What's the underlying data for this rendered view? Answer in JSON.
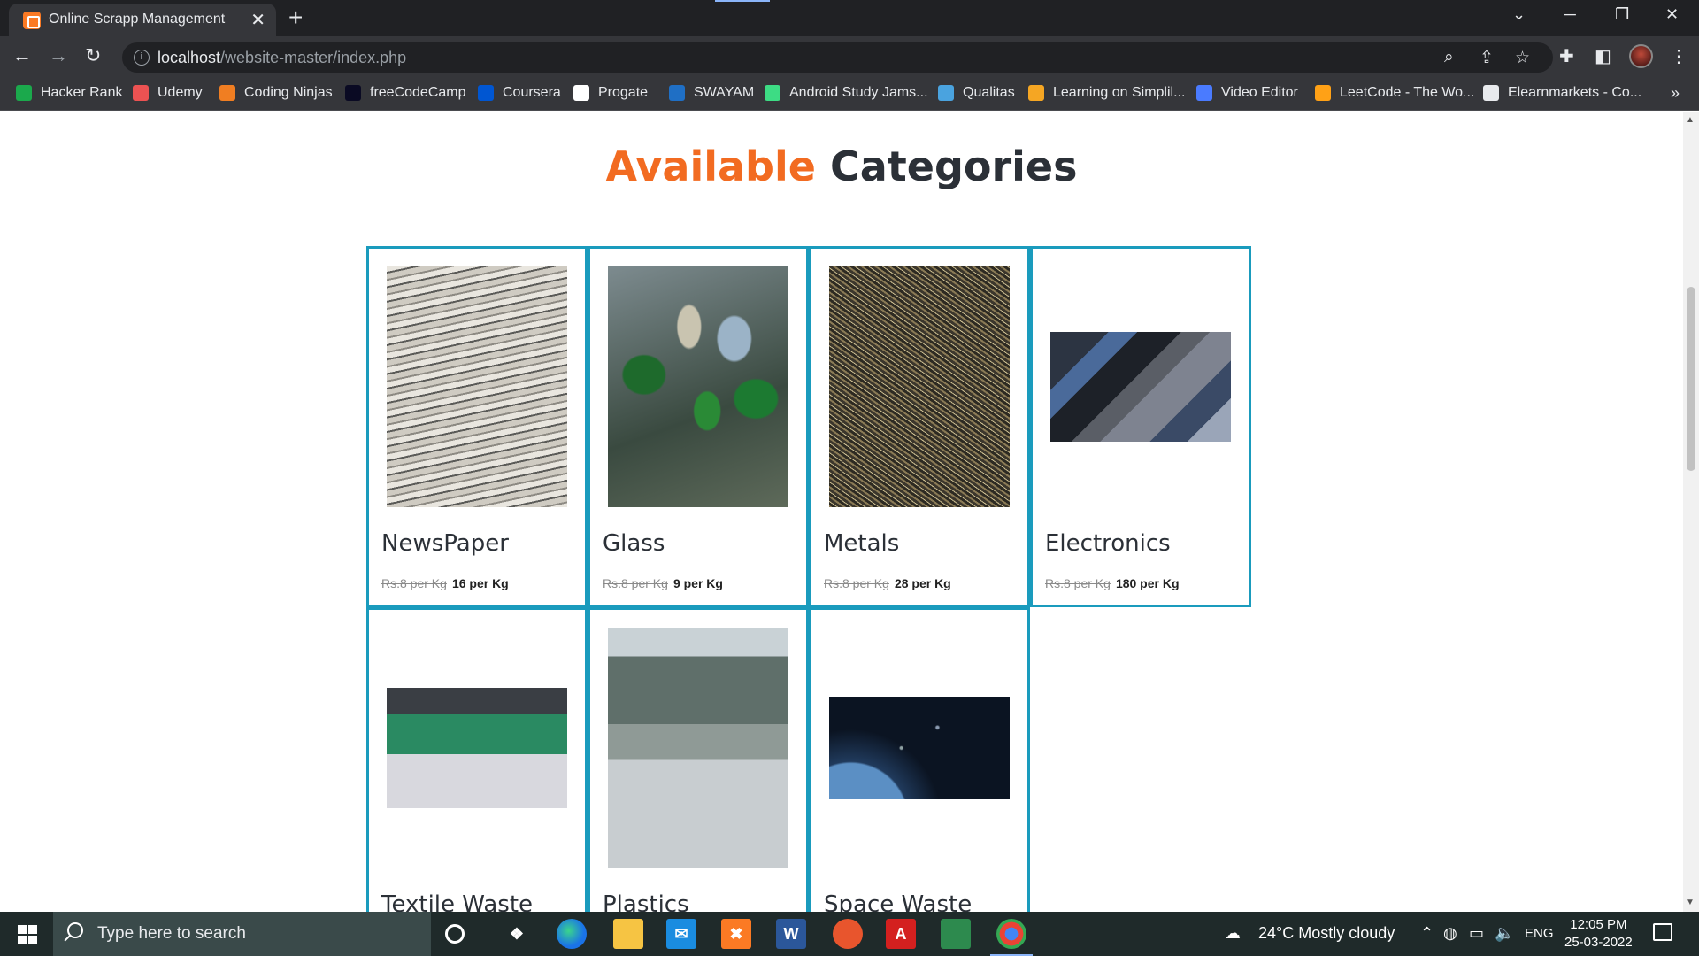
{
  "browser": {
    "tab_title": "Online Scrapp Management",
    "url_host": "localhost",
    "url_path": "/website-master/index.php",
    "bookmarks": [
      {
        "label": "Hacker Rank",
        "icon": "hackerrank-icon",
        "color": "#1ba94c"
      },
      {
        "label": "Udemy",
        "icon": "udemy-icon",
        "color": "#ec5252"
      },
      {
        "label": "Coding Ninjas",
        "icon": "codingninjas-icon",
        "color": "#f07e22"
      },
      {
        "label": "freeCodeCamp",
        "icon": "freecodecamp-icon",
        "color": "#0a0a23"
      },
      {
        "label": "Coursera",
        "icon": "coursera-icon",
        "color": "#0056d2"
      },
      {
        "label": "Progate",
        "icon": "progate-icon",
        "color": "#ffffff"
      },
      {
        "label": "SWAYAM",
        "icon": "swayam-icon",
        "color": "#1f6fc5"
      },
      {
        "label": "Android Study Jams...",
        "icon": "android-icon",
        "color": "#3ddc84"
      },
      {
        "label": "Qualitas",
        "icon": "qualitas-icon",
        "color": "#4aa3df"
      },
      {
        "label": "Learning on Simplil...",
        "icon": "simplilearn-icon",
        "color": "#f5a623"
      },
      {
        "label": "Video Editor",
        "icon": "video-editor-icon",
        "color": "#4a7bff"
      },
      {
        "label": "LeetCode - The Wo...",
        "icon": "leetcode-icon",
        "color": "#ffa116"
      },
      {
        "label": "Elearnmarkets - Co...",
        "icon": "elearnmarkets-icon",
        "color": "#e8eaed"
      }
    ]
  },
  "page": {
    "heading_highlight": "Available",
    "heading_rest": "Categories",
    "categories": [
      {
        "name": "NewsPaper",
        "old_price": "Rs.8 per Kg",
        "new_price": "16 per Kg"
      },
      {
        "name": "Glass",
        "old_price": "Rs.8 per Kg",
        "new_price": "9 per Kg"
      },
      {
        "name": "Metals",
        "old_price": "Rs.8 per Kg",
        "new_price": "28 per Kg"
      },
      {
        "name": "Electronics",
        "old_price": "Rs.8 per Kg",
        "new_price": "180 per Kg"
      },
      {
        "name": "Textile Waste"
      },
      {
        "name": "Plastics"
      },
      {
        "name": "Space Waste"
      }
    ],
    "accent_color": "#f26b21",
    "border_color": "#1a9bbd"
  },
  "taskbar": {
    "search_placeholder": "Type here to search",
    "weather": "24°C  Mostly cloudy",
    "language": "ENG",
    "time": "12:05 PM",
    "date": "25-03-2022"
  }
}
